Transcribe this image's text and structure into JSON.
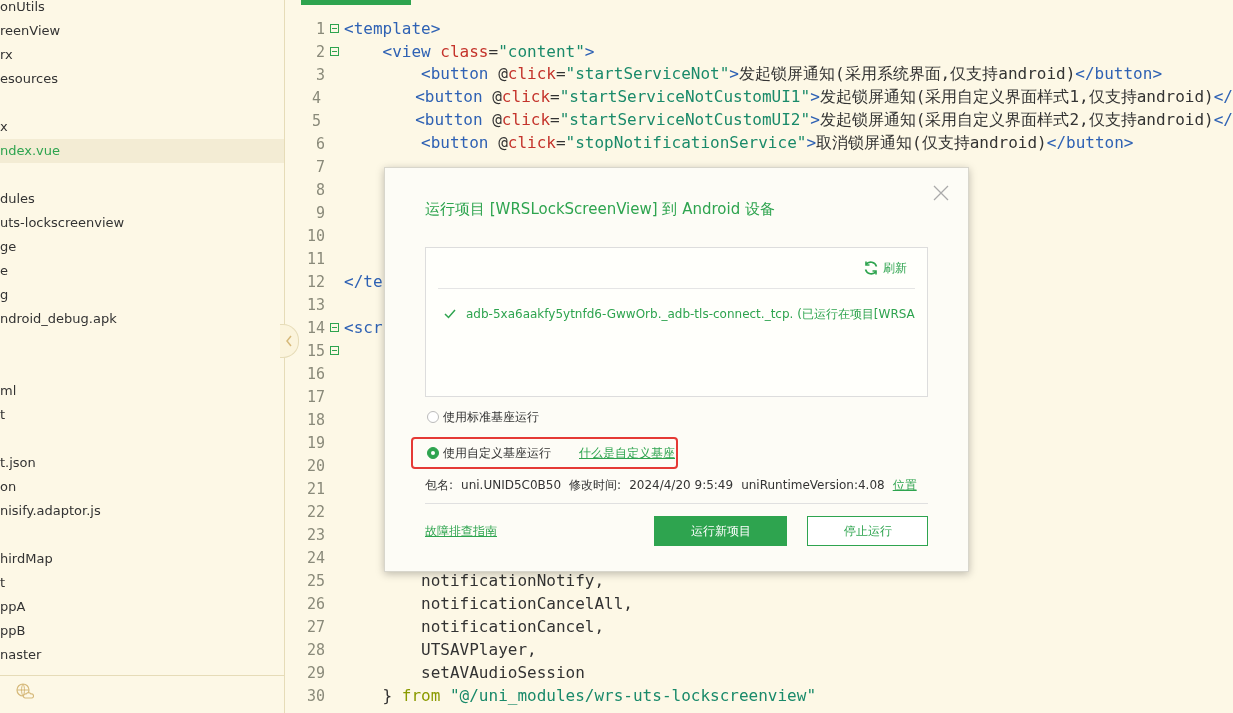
{
  "sidebar": {
    "items": [
      {
        "kind": "file",
        "label": "onUtils",
        "selected": false
      },
      {
        "kind": "file",
        "label": "reenView",
        "selected": false
      },
      {
        "kind": "file",
        "label": "rx",
        "selected": false
      },
      {
        "kind": "file",
        "label": "esources",
        "selected": false
      },
      {
        "kind": "spacer"
      },
      {
        "kind": "file",
        "label": "x",
        "selected": false
      },
      {
        "kind": "file",
        "label": "ndex.vue",
        "selected": true
      },
      {
        "kind": "spacer"
      },
      {
        "kind": "file",
        "label": "dules",
        "selected": false
      },
      {
        "kind": "file",
        "label": "uts-lockscreenview",
        "selected": false
      },
      {
        "kind": "file",
        "label": "ge",
        "selected": false
      },
      {
        "kind": "file",
        "label": "e",
        "selected": false
      },
      {
        "kind": "file",
        "label": "g",
        "selected": false
      },
      {
        "kind": "file",
        "label": "ndroid_debug.apk",
        "selected": false
      },
      {
        "kind": "spacer"
      },
      {
        "kind": "spacer"
      },
      {
        "kind": "file",
        "label": "ml",
        "selected": false
      },
      {
        "kind": "file",
        "label": "t",
        "selected": false
      },
      {
        "kind": "spacer"
      },
      {
        "kind": "file",
        "label": "t.json",
        "selected": false
      },
      {
        "kind": "file",
        "label": "on",
        "selected": false
      },
      {
        "kind": "file",
        "label": "nisify.adaptor.js",
        "selected": false
      },
      {
        "kind": "spacer"
      },
      {
        "kind": "file",
        "label": "hirdMap",
        "selected": false
      },
      {
        "kind": "file",
        "label": "t",
        "selected": false
      },
      {
        "kind": "file",
        "label": "ppA",
        "selected": false
      },
      {
        "kind": "file",
        "label": "ppB",
        "selected": false
      },
      {
        "kind": "file",
        "label": "naster",
        "selected": false
      }
    ]
  },
  "editor": {
    "lines": [
      {
        "number": "1",
        "fold": true,
        "tokens": [
          {
            "t": "<template>",
            "kind": "tag"
          }
        ]
      },
      {
        "number": "2",
        "fold": true,
        "tokens": [
          {
            "t": "    <view ",
            "kind": "tag"
          },
          {
            "t": "class",
            "kind": "attr"
          },
          {
            "t": "=",
            "kind": "plain"
          },
          {
            "t": "\"content\"",
            "kind": "str"
          },
          {
            "t": ">",
            "kind": "tag"
          }
        ]
      },
      {
        "number": "3",
        "fold": false,
        "tokens": [
          {
            "t": "        <button",
            "kind": "tag"
          },
          {
            "t": " @",
            "kind": "plain"
          },
          {
            "t": "click",
            "kind": "attr"
          },
          {
            "t": "=",
            "kind": "plain"
          },
          {
            "t": "\"startServiceNot\"",
            "kind": "str"
          },
          {
            "t": ">",
            "kind": "tag"
          },
          {
            "t": "发起锁屏通知(采用系统界面,仅支持android)",
            "kind": "plain"
          },
          {
            "t": "</button>",
            "kind": "tag"
          }
        ]
      },
      {
        "number": "4",
        "fold": false,
        "tokens": [
          {
            "t": "        <button",
            "kind": "tag"
          },
          {
            "t": " @",
            "kind": "plain"
          },
          {
            "t": "click",
            "kind": "attr"
          },
          {
            "t": "=",
            "kind": "plain"
          },
          {
            "t": "\"startServiceNotCustomUI1\"",
            "kind": "str"
          },
          {
            "t": ">",
            "kind": "tag"
          },
          {
            "t": "发起锁屏通知(采用自定义界面样式1,仅支持android)",
            "kind": "plain"
          },
          {
            "t": "</",
            "kind": "tag"
          }
        ]
      },
      {
        "number": "5",
        "fold": false,
        "tokens": [
          {
            "t": "        <button",
            "kind": "tag"
          },
          {
            "t": " @",
            "kind": "plain"
          },
          {
            "t": "click",
            "kind": "attr"
          },
          {
            "t": "=",
            "kind": "plain"
          },
          {
            "t": "\"startServiceNotCustomUI2\"",
            "kind": "str"
          },
          {
            "t": ">",
            "kind": "tag"
          },
          {
            "t": "发起锁屏通知(采用自定义界面样式2,仅支持android)",
            "kind": "plain"
          },
          {
            "t": "</",
            "kind": "tag"
          }
        ]
      },
      {
        "number": "6",
        "fold": false,
        "tokens": [
          {
            "t": "        <button",
            "kind": "tag"
          },
          {
            "t": " @",
            "kind": "plain"
          },
          {
            "t": "click",
            "kind": "attr"
          },
          {
            "t": "=",
            "kind": "plain"
          },
          {
            "t": "\"stopNotificationService\"",
            "kind": "str"
          },
          {
            "t": ">",
            "kind": "tag"
          },
          {
            "t": "取消锁屏通知(仅支持android)",
            "kind": "plain"
          },
          {
            "t": "</button>",
            "kind": "tag"
          }
        ]
      },
      {
        "number": "7",
        "fold": false
      },
      {
        "number": "8",
        "fold": false
      },
      {
        "number": "9",
        "fold": false
      },
      {
        "number": "10",
        "fold": false
      },
      {
        "number": "11",
        "fold": false
      },
      {
        "number": "12",
        "fold": false,
        "tokens": [
          {
            "t": "</te",
            "kind": "tag"
          }
        ]
      },
      {
        "number": "13",
        "fold": false
      },
      {
        "number": "14",
        "fold": true,
        "tokens": [
          {
            "t": "<scr",
            "kind": "tag"
          }
        ]
      },
      {
        "number": "15",
        "fold": true
      },
      {
        "number": "16",
        "fold": false
      },
      {
        "number": "17",
        "fold": false
      },
      {
        "number": "18",
        "fold": false
      },
      {
        "number": "19",
        "fold": false
      },
      {
        "number": "20",
        "fold": false
      },
      {
        "number": "21",
        "fold": false
      },
      {
        "number": "22",
        "fold": false
      },
      {
        "number": "23",
        "fold": false
      },
      {
        "number": "24",
        "fold": false
      },
      {
        "number": "25",
        "fold": false,
        "tokens": [
          {
            "t": "        notificationNotify,",
            "kind": "plain"
          }
        ]
      },
      {
        "number": "26",
        "fold": false,
        "tokens": [
          {
            "t": "        notificationCancelAll,",
            "kind": "plain"
          }
        ]
      },
      {
        "number": "27",
        "fold": false,
        "tokens": [
          {
            "t": "        notificationCancel,",
            "kind": "plain"
          }
        ]
      },
      {
        "number": "28",
        "fold": false,
        "tokens": [
          {
            "t": "        UTSAVPlayer,",
            "kind": "plain"
          }
        ]
      },
      {
        "number": "29",
        "fold": false,
        "tokens": [
          {
            "t": "        setAVAudioSession",
            "kind": "plain"
          }
        ]
      },
      {
        "number": "30",
        "fold": false,
        "tokens": [
          {
            "t": "    } ",
            "kind": "plain"
          },
          {
            "t": "from",
            "kind": "kw"
          },
          {
            "t": " \"@/uni_modules/wrs-uts-lockscreenview\"",
            "kind": "str"
          }
        ]
      }
    ]
  },
  "dialog": {
    "title": "运行项目 [WRSLockScreenView] 到 Android 设备",
    "refresh": "刷新",
    "devices": [
      {
        "name": "adb-5xa6aakfy5ytnfd6-GwwOrb._adb-tls-connect._tcp. (已运行在项目[WRSA",
        "checked": true
      }
    ],
    "options": [
      {
        "label": "使用标准基座运行",
        "selected": false,
        "highlighted": false
      },
      {
        "label": "使用自定义基座运行",
        "selected": true,
        "link": "什么是自定义基座",
        "highlighted": true
      }
    ],
    "info": {
      "package_label": "包名:",
      "package": "uni.UNID5C0B50",
      "modified_label": "修改时间:",
      "modified": "2024/4/20 9:5:49",
      "runtime": "uniRuntimeVersion:4.08",
      "location_link": "位置"
    },
    "help_link": "故障排查指南",
    "buttons": [
      {
        "label": "运行新项目",
        "kind": "primary"
      },
      {
        "label": "停止运行",
        "kind": "secondary"
      }
    ]
  }
}
